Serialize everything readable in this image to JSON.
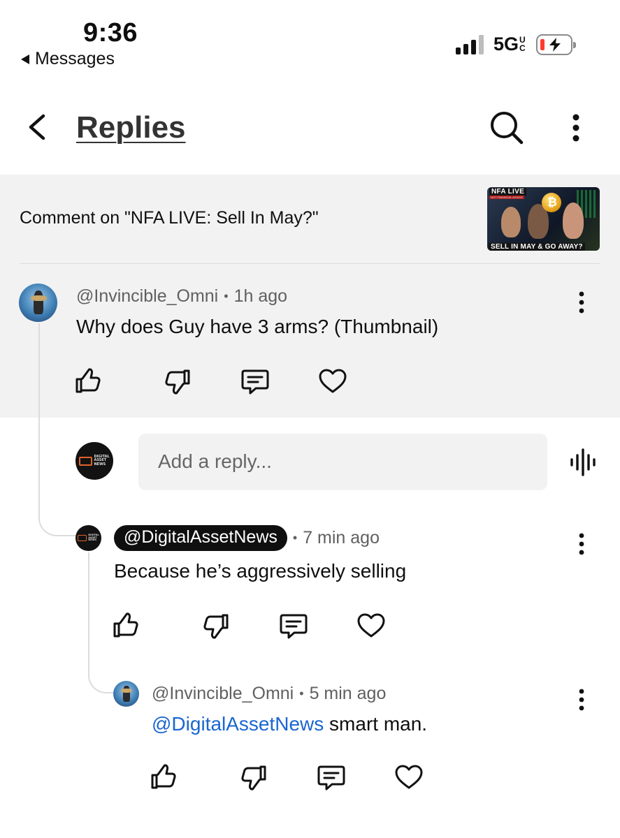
{
  "status_bar": {
    "time": "9:36",
    "back_app": "Messages",
    "network": "5G",
    "network_sub": "UC"
  },
  "header": {
    "title": "Replies"
  },
  "context": {
    "comment_on": "Comment on \"NFA LIVE: Sell In May?\"",
    "thumbnail_top": "NFA LIVE",
    "thumbnail_sub": "NOT FINANCIAL ADVICE",
    "thumbnail_bottom": "SELL IN MAY & GO AWAY?"
  },
  "original_comment": {
    "author": "@Invincible_Omni",
    "separator": "•",
    "time": "1h ago",
    "text": "Why does Guy have 3 arms? (Thumbnail)"
  },
  "reply_box": {
    "placeholder": "Add a reply..."
  },
  "replies": [
    {
      "author": "@DigitalAssetNews",
      "separator": "•",
      "time": "7 min ago",
      "text": "Because he’s aggressively selling"
    },
    {
      "author": "@Invincible_Omni",
      "separator": "•",
      "time": "5 min ago",
      "mention": "@DigitalAssetNews",
      "text": " smart man."
    }
  ],
  "channel_logo_text": [
    "DIGITAL",
    "ASSET",
    "NEWS"
  ],
  "icons": {
    "back": "chevron-left-icon",
    "search": "search-icon",
    "more": "more-vertical-icon",
    "like": "thumbs-up-icon",
    "dislike": "thumbs-down-icon",
    "reply": "comment-icon",
    "heart": "heart-icon",
    "voice": "voice-icon"
  }
}
